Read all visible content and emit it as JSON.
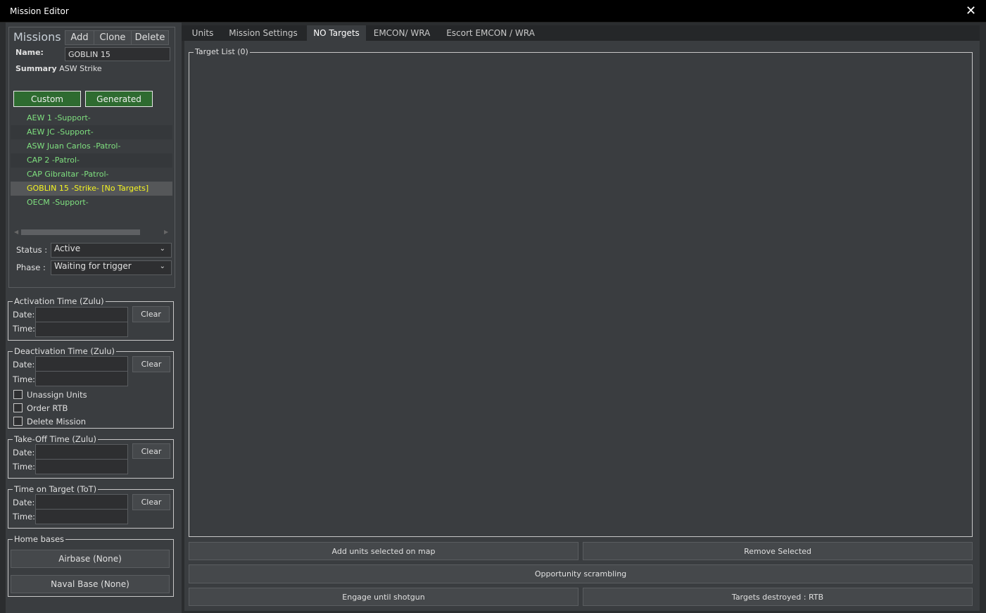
{
  "window": {
    "title": "Mission Editor",
    "close_icon": "close-icon"
  },
  "missions": {
    "heading": "Missions",
    "add": "Add",
    "clone": "Clone",
    "delete": "Delete",
    "name_label": "Name:",
    "name_value": "GOBLIN 15",
    "summary_label": "Summary",
    "summary_value": "ASW Strike",
    "custom": "Custom",
    "generated": "Generated",
    "items": [
      {
        "label": "AEW 1  -Support-",
        "selected": false
      },
      {
        "label": "AEW JC  -Support-",
        "selected": false
      },
      {
        "label": "ASW Juan Carlos  -Patrol-",
        "selected": false
      },
      {
        "label": "CAP 2  -Patrol-",
        "selected": false
      },
      {
        "label": "CAP Gibraltar  -Patrol-",
        "selected": false
      },
      {
        "label": "GOBLIN 15  -Strike- [No Targets]",
        "selected": true
      },
      {
        "label": "OECM  -Support-",
        "selected": false
      }
    ],
    "status_label": "Status :",
    "status_value": "Active",
    "phase_label": "Phase :",
    "phase_value": "Waiting for trigger"
  },
  "times": {
    "date": "Date:",
    "time": "Time:",
    "clear": "Clear",
    "activation": "Activation Time (Zulu)",
    "deactivation": "Deactivation Time (Zulu)",
    "takeoff": "Take-Off Time (Zulu)",
    "tot": "Time on Target (ToT)",
    "unassign": "Unassign Units",
    "order_rtb": "Order RTB",
    "delete_mission": "Delete Mission"
  },
  "home": {
    "legend": "Home bases",
    "airbase": "Airbase (None)",
    "naval": "Naval Base (None)"
  },
  "tabs": [
    "Units",
    "Mission Settings",
    "NO Targets",
    "EMCON/ WRA",
    "Escort EMCON / WRA"
  ],
  "targets": {
    "legend": "Target List (0)",
    "add": "Add units selected on map",
    "remove": "Remove Selected",
    "opportunity": "Opportunity scrambling",
    "engage": "Engage until shotgun",
    "destroyed": "Targets destroyed : RTB"
  }
}
